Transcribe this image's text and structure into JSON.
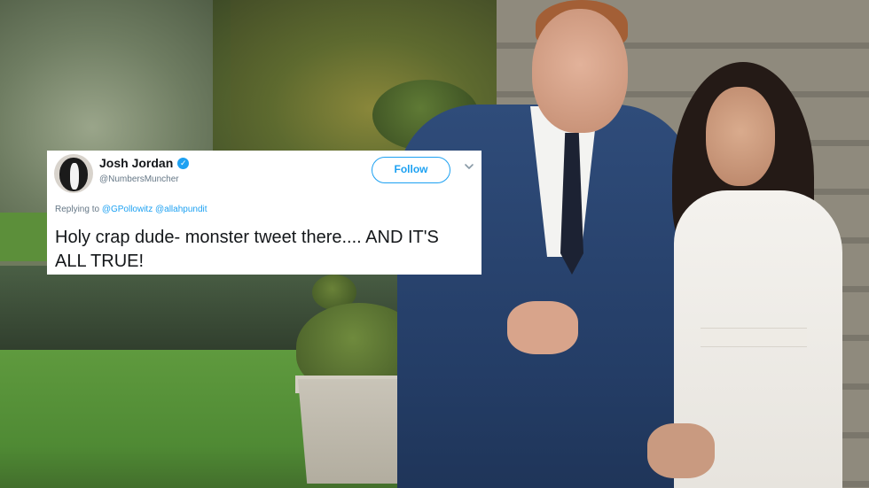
{
  "tweet": {
    "author_name": "Josh Jordan",
    "author_handle": "@NumbersMuncher",
    "follow_label": "Follow",
    "replying_prefix": "Replying to",
    "reply_mentions": [
      "@GPollowitz",
      "@allahpundit"
    ],
    "text": "Holy crap dude- monster tweet there.... AND IT'S ALL TRUE!",
    "verified": true
  },
  "icons": {
    "verified": "verified-badge-icon",
    "menu": "chevron-down-icon"
  },
  "colors": {
    "twitter_blue": "#1da1f2",
    "text_primary": "#14171a",
    "text_secondary": "#657786",
    "card_background": "#ffffff"
  }
}
